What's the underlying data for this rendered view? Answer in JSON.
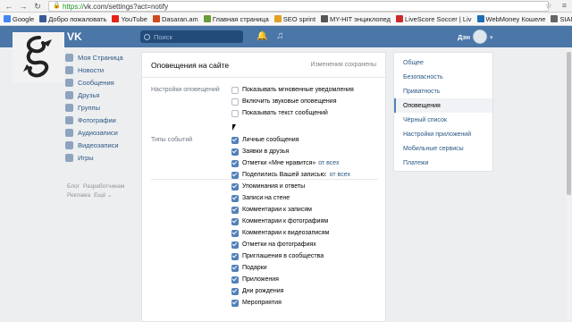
{
  "browser": {
    "url_scheme": "https://",
    "url_host": "vk.com",
    "url_path": "/settings?act=notify",
    "bookmarks": [
      {
        "label": "Google",
        "color": "#4285f4"
      },
      {
        "label": "Добро пожаловать",
        "color": "#3b5998"
      },
      {
        "label": "YouTube",
        "color": "#e62117"
      },
      {
        "label": "Dasaran.am",
        "color": "#d04a1d"
      },
      {
        "label": "Главная страница",
        "color": "#6a9c3b"
      },
      {
        "label": "SEO sprint",
        "color": "#e0a020"
      },
      {
        "label": "MY-HIT энциклопед",
        "color": "#555555"
      },
      {
        "label": "LiveScore Soccer | Liv",
        "color": "#cc2a2a"
      },
      {
        "label": "WebMoney Кошеле",
        "color": "#1c6fb5"
      },
      {
        "label": "SIAMMEDIA",
        "color": "#666666"
      }
    ]
  },
  "header": {
    "logo": "VK",
    "search_placeholder": "Поиск",
    "user_name": "Дэн"
  },
  "leftnav": {
    "items": [
      "Моя Страница",
      "Новости",
      "Сообщения",
      "Друзья",
      "Группы",
      "Фотографии",
      "Аудиозаписи",
      "Видеозаписи",
      "Игры"
    ],
    "footer": [
      "Блог",
      "Разработчикам",
      "Реклама",
      "Ещё ⌄"
    ]
  },
  "card": {
    "title": "Оповещения на сайте",
    "status": "Изменения сохранены",
    "section1_label": "Настройки оповещений",
    "section1_options": [
      {
        "label": "Показывать мгновенные уведомления",
        "checked": false
      },
      {
        "label": "Включить звуковые оповещения",
        "checked": false
      },
      {
        "label": "Показывать текст сообщений",
        "checked": false
      }
    ],
    "section2_label": "Типы событий",
    "section2_options": [
      {
        "label": "Личные сообщения",
        "checked": true,
        "sub": ""
      },
      {
        "label": "Заявки в друзья",
        "checked": true,
        "sub": ""
      },
      {
        "label": "Отметки «Мне нравится»",
        "checked": true,
        "sub": "от всех"
      },
      {
        "label": "Поделились Вашей записью:",
        "checked": true,
        "sub": "от всех"
      },
      {
        "label": "Упоминания и ответы",
        "checked": true,
        "sub": ""
      },
      {
        "label": "Записи на стене",
        "checked": true,
        "sub": ""
      },
      {
        "label": "Комментарии к записям",
        "checked": true,
        "sub": ""
      },
      {
        "label": "Комментарии к фотографиям",
        "checked": true,
        "sub": ""
      },
      {
        "label": "Комментарии к видеозаписям",
        "checked": true,
        "sub": ""
      },
      {
        "label": "Отметки на фотографиях",
        "checked": true,
        "sub": ""
      },
      {
        "label": "Приглашения в сообщества",
        "checked": true,
        "sub": ""
      },
      {
        "label": "Подарки",
        "checked": true,
        "sub": ""
      },
      {
        "label": "Приложения",
        "checked": true,
        "sub": ""
      },
      {
        "label": "Дни рождения",
        "checked": true,
        "sub": ""
      },
      {
        "label": "Мероприятия",
        "checked": true,
        "sub": ""
      }
    ]
  },
  "rightmenu": {
    "items": [
      {
        "label": "Общее",
        "active": false
      },
      {
        "label": "Безопасность",
        "active": false
      },
      {
        "label": "Приватность",
        "active": false
      },
      {
        "label": "Оповещения",
        "active": true
      },
      {
        "label": "Чёрный список",
        "active": false
      },
      {
        "label": "Настройки приложений",
        "active": false
      },
      {
        "label": "Мобильные сервисы",
        "active": false
      },
      {
        "label": "Платежи",
        "active": false
      }
    ]
  }
}
